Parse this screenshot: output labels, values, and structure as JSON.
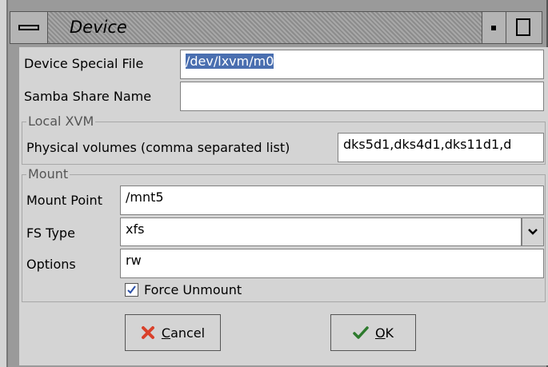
{
  "window": {
    "title": "Device"
  },
  "fields": {
    "device_special_file": {
      "label": "Device Special File",
      "value": "/dev/lxvm/m0"
    },
    "samba_share_name": {
      "label": "Samba Share Name",
      "value": ""
    }
  },
  "local_xvm": {
    "title": "Local XVM",
    "physical_volumes": {
      "label": "Physical volumes (comma separated list)",
      "value": "dks5d1,dks4d1,dks11d1,d"
    }
  },
  "mount": {
    "title": "Mount",
    "mount_point": {
      "label": "Mount Point",
      "value": "/mnt5"
    },
    "fs_type": {
      "label": "FS Type",
      "value": "xfs"
    },
    "options": {
      "label": "Options",
      "value": "rw"
    },
    "force_unmount": {
      "label": "Force Unmount",
      "checked": true
    }
  },
  "buttons": {
    "cancel": {
      "mnemonic": "C",
      "rest": "ancel",
      "icon": "x-icon"
    },
    "ok": {
      "mnemonic": "O",
      "rest": "K",
      "icon": "checkmark-icon"
    }
  },
  "colors": {
    "selection": "#4a6fb0",
    "cancel_icon": "#d9412b",
    "ok_icon": "#2d7a2d"
  }
}
